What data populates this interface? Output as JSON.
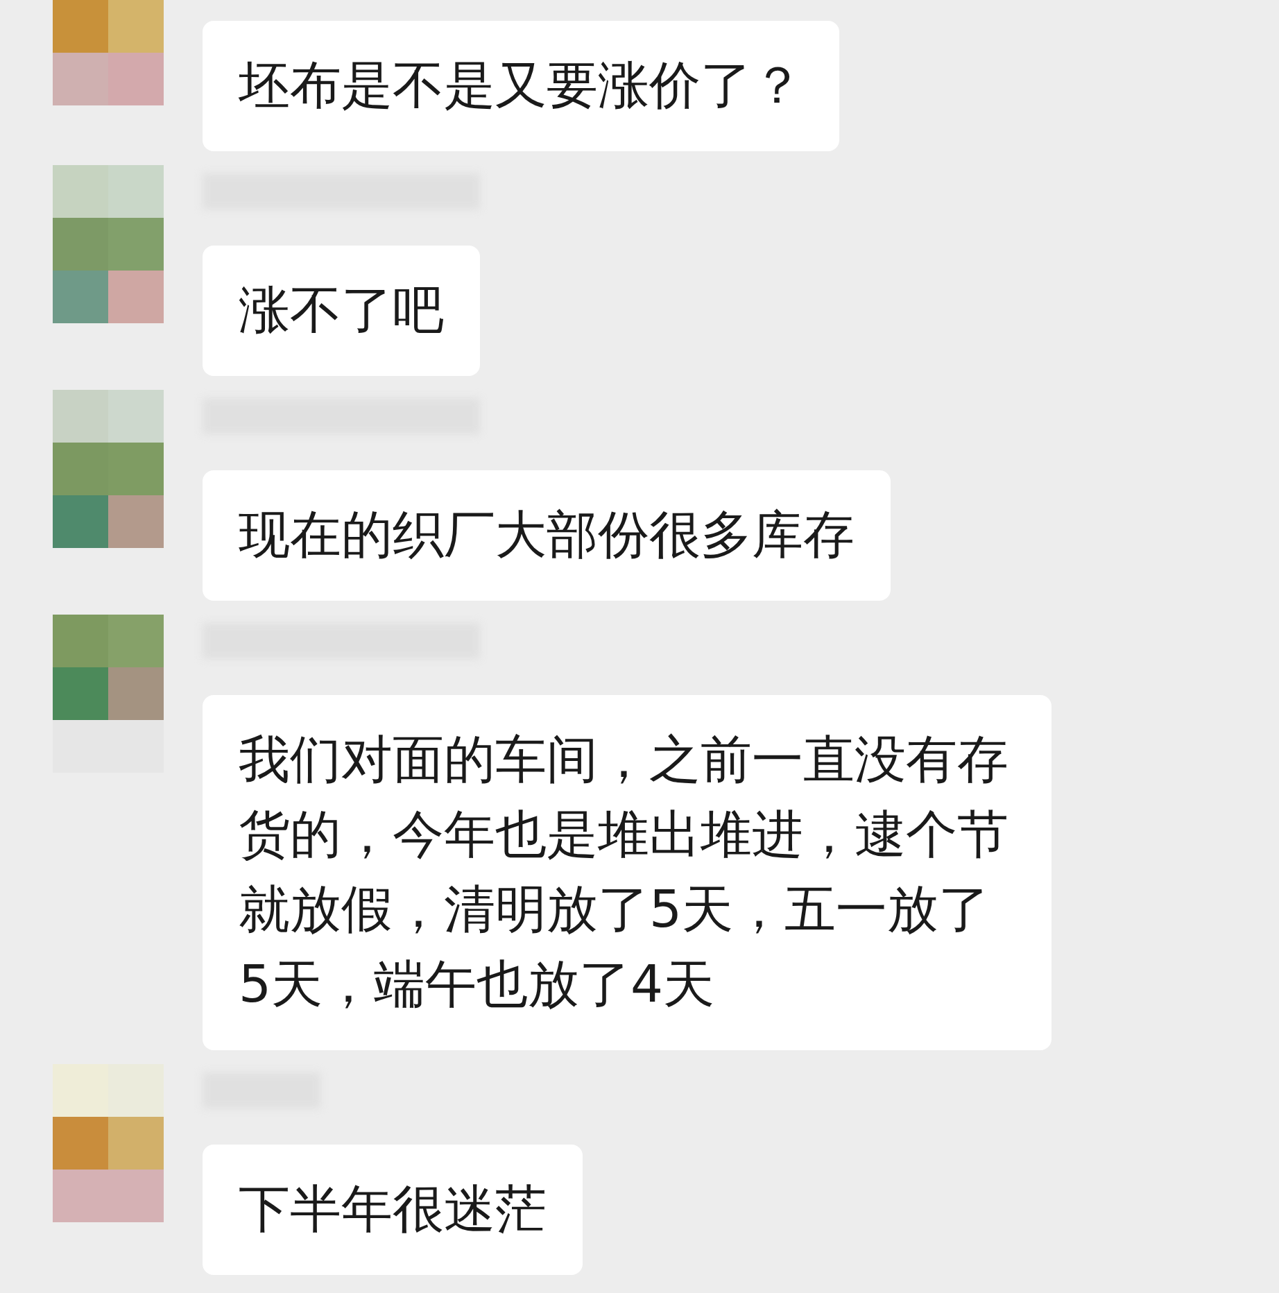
{
  "messages": [
    {
      "text": "坯布是不是又要涨价了？",
      "name_blurred": false
    },
    {
      "text": "涨不了吧",
      "name_blurred": true
    },
    {
      "text": "现在的织厂大部份很多库存",
      "name_blurred": true
    },
    {
      "text": "我们对面的车间，之前一直没有存货的，今年也是堆出堆进，逮个节就放假，清明放了5天，五一放了5天，端午也放了4天",
      "name_blurred": true
    },
    {
      "text": "下半年很迷茫",
      "name_blurred": true
    }
  ]
}
